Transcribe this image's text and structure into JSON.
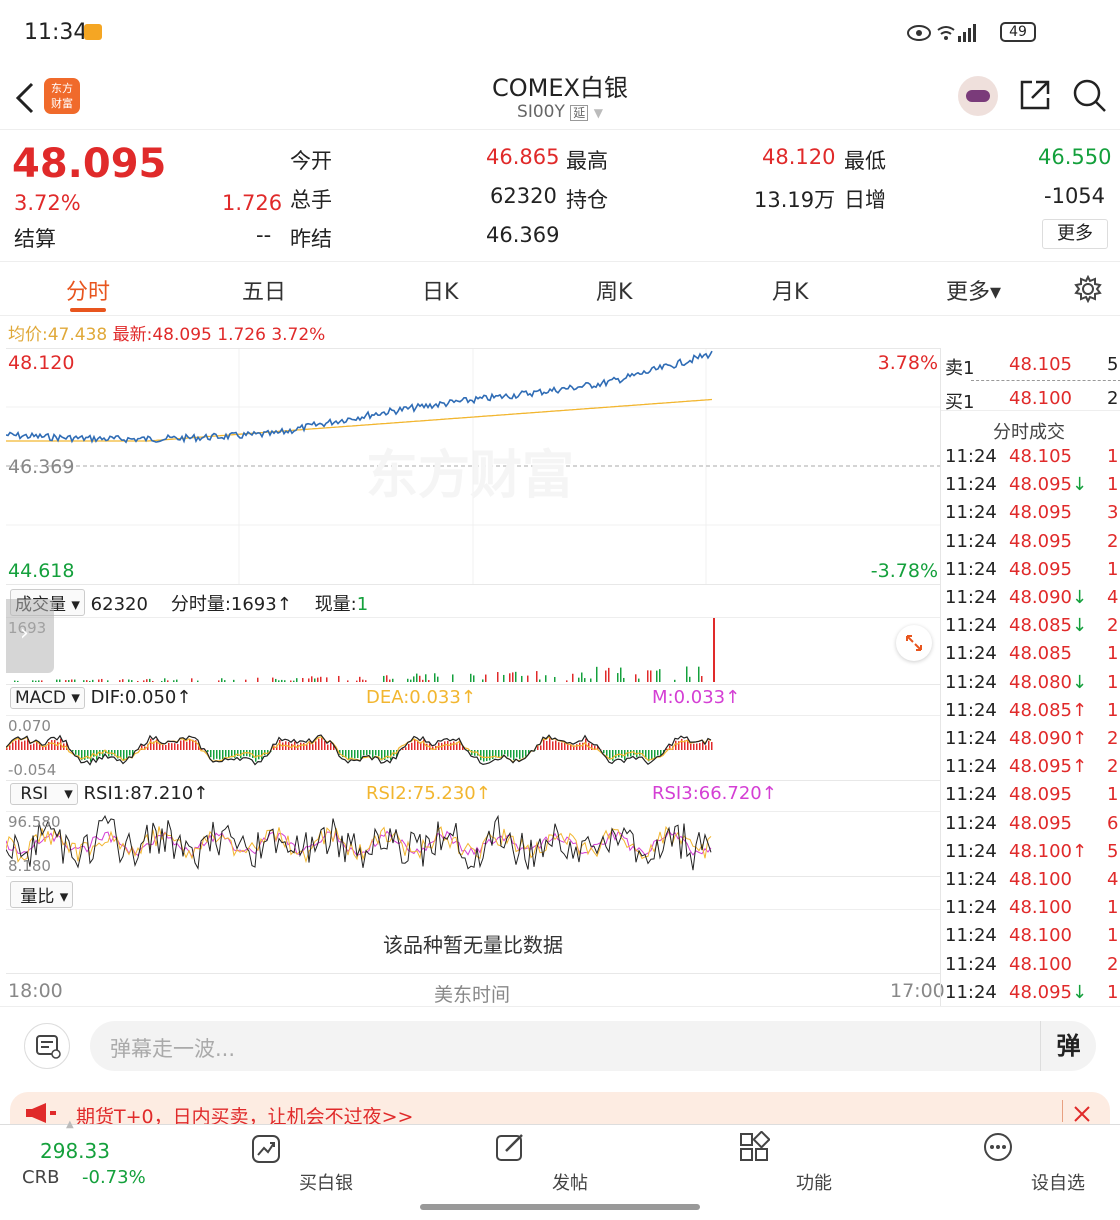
{
  "status_bar": {
    "time": "11:34",
    "battery": "49"
  },
  "header": {
    "title": "COMEX白银",
    "subtitle": "SI00Y",
    "delayed_badge": "延",
    "logo_text_top": "东方",
    "logo_text_bottom": "财富"
  },
  "quote": {
    "price": "48.095",
    "change_pct": "3.72%",
    "change": "1.726",
    "settle_label": "结算",
    "settle_value": "--",
    "open_label": "今开",
    "open_value": "46.865",
    "high_label": "最高",
    "high_value": "48.120",
    "low_label": "最低",
    "low_value": "46.550",
    "volume_label": "总手",
    "volume_value": "62320",
    "oi_label": "持仓",
    "oi_value": "13.19万",
    "daily_inc_label": "日增",
    "daily_inc_value": "-1054",
    "prev_settle_label": "昨结",
    "prev_settle_value": "46.369",
    "more_button": "更多"
  },
  "tabs": {
    "items": [
      "分时",
      "五日",
      "日K",
      "周K",
      "月K",
      "更多▾"
    ],
    "active": 0
  },
  "price_chart": {
    "avg_label": "均价:",
    "avg_value": "47.438",
    "latest_label": "最新:",
    "latest_value": "48.095",
    "latest_change": "1.726",
    "latest_pct": "3.72%",
    "top_price": "48.120",
    "top_pct": "3.78%",
    "mid_price": "46.369",
    "bottom_price": "44.618",
    "bottom_pct": "-3.78%",
    "watermark": "东方财富",
    "x_start": "18:00",
    "x_mid": "美东时间",
    "x_end": "17:00"
  },
  "volume_panel": {
    "selector": "成交量",
    "total": "62320",
    "tick_vol_label": "分时量:1693↑",
    "current_label": "现量:",
    "current_value": "1",
    "scale_top": "1693"
  },
  "macd_panel": {
    "selector": "MACD",
    "dif": "DIF:0.050↑",
    "dea": "DEA:0.033↑",
    "m": "M:0.033↑",
    "scale_top": "0.070",
    "scale_bottom": "-0.054"
  },
  "rsi_panel": {
    "selector": "RSI",
    "rsi1": "RSI1:87.210↑",
    "rsi2": "RSI2:75.230↑",
    "rsi3": "RSI3:66.720↑",
    "scale_top": "96.580",
    "scale_bottom": "8.180"
  },
  "ratio_panel": {
    "selector": "量比",
    "empty_text": "该品种暂无量比数据"
  },
  "order_book": {
    "sell1_label": "卖1",
    "sell1_price": "48.105",
    "sell1_vol": "5",
    "buy1_label": "买1",
    "buy1_price": "48.100",
    "buy1_vol": "2",
    "ticks_title": "分时成交",
    "ticks": [
      {
        "time": "11:24",
        "price": "48.105",
        "vol": "1"
      },
      {
        "time": "11:24",
        "price": "48.095↓",
        "vol": "1"
      },
      {
        "time": "11:24",
        "price": "48.095",
        "vol": "3"
      },
      {
        "time": "11:24",
        "price": "48.095",
        "vol": "2"
      },
      {
        "time": "11:24",
        "price": "48.095",
        "vol": "1"
      },
      {
        "time": "11:24",
        "price": "48.090↓",
        "vol": "4"
      },
      {
        "time": "11:24",
        "price": "48.085↓",
        "vol": "2"
      },
      {
        "time": "11:24",
        "price": "48.085",
        "vol": "1"
      },
      {
        "time": "11:24",
        "price": "48.080↓",
        "vol": "1"
      },
      {
        "time": "11:24",
        "price": "48.085↑",
        "vol": "1"
      },
      {
        "time": "11:24",
        "price": "48.090↑",
        "vol": "2"
      },
      {
        "time": "11:24",
        "price": "48.095↑",
        "vol": "2"
      },
      {
        "time": "11:24",
        "price": "48.095",
        "vol": "1"
      },
      {
        "time": "11:24",
        "price": "48.095",
        "vol": "6"
      },
      {
        "time": "11:24",
        "price": "48.100↑",
        "vol": "5"
      },
      {
        "time": "11:24",
        "price": "48.100",
        "vol": "4"
      },
      {
        "time": "11:24",
        "price": "48.100",
        "vol": "1"
      },
      {
        "time": "11:24",
        "price": "48.100",
        "vol": "1"
      },
      {
        "time": "11:24",
        "price": "48.100",
        "vol": "2"
      },
      {
        "time": "11:24",
        "price": "48.095↓",
        "vol": "1"
      }
    ]
  },
  "comment": {
    "placeholder": "弹幕走一波...",
    "danmu_button": "弹"
  },
  "ad_banner": {
    "text": "期货T+0，日内买卖，让机会不过夜>>"
  },
  "bottom_nav": {
    "index_value": "298.33",
    "index_name": "CRB",
    "index_change": "-0.73%",
    "items": [
      "买白银",
      "发帖",
      "功能",
      "设自选"
    ]
  },
  "colors": {
    "accent": "#e8551e",
    "up": "#e02a2a",
    "down": "#14a03c",
    "price_line": "#2f6cb5",
    "avg_line": "#f2b630",
    "rsi2": "#f2b630",
    "rsi3": "#d43fd4"
  }
}
